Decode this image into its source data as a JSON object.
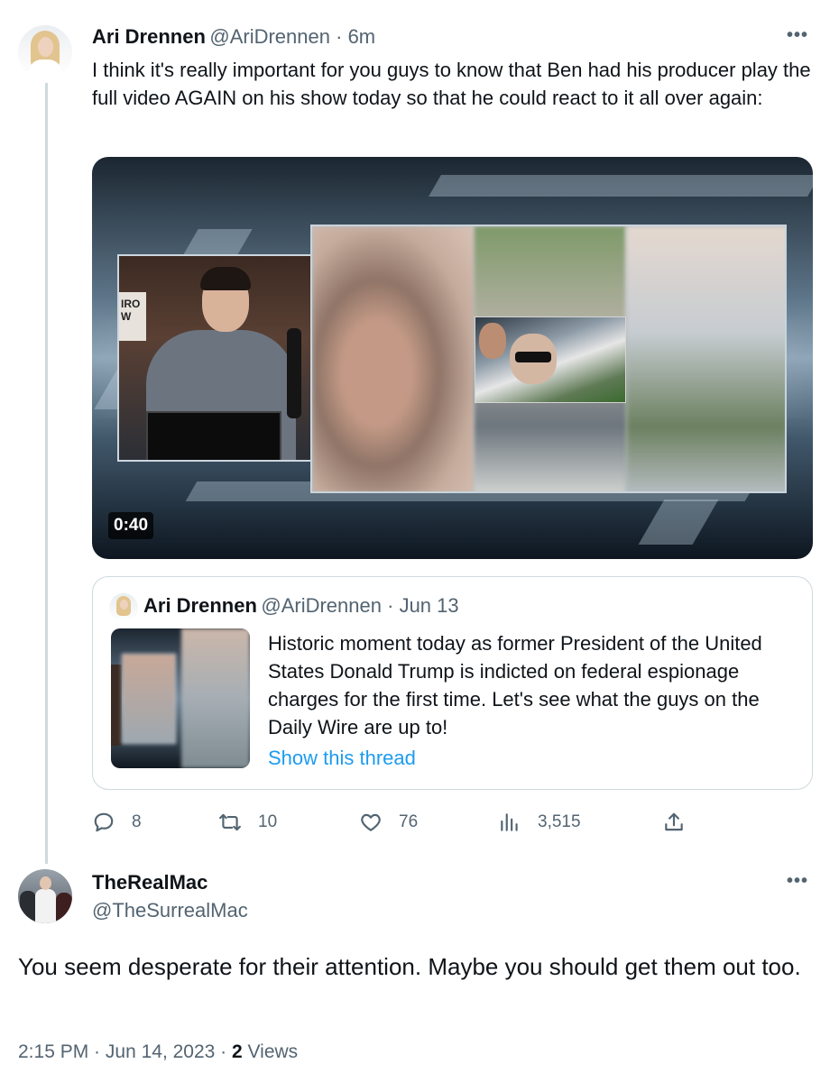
{
  "tweet1": {
    "name": "Ari Drennen",
    "handle": "@AriDrennen",
    "separator": " · ",
    "time": "6m",
    "text": "I think it's really important for you guys to know that Ben had his producer play the full video AGAIN on his show today so that he could react to it all over again:",
    "video": {
      "duration": "0:40",
      "sign_text": "IRO\nW"
    },
    "quote": {
      "name": "Ari Drennen",
      "handle": "@AriDrennen",
      "separator": " · ",
      "date": "Jun 13",
      "text": "Historic moment today as former President of the United States Donald Trump is indicted on federal espionage charges for the first time. Let's see what the guys on the Daily Wire are up to!",
      "show_thread": "Show this thread"
    },
    "actions": {
      "replies": "8",
      "retweets": "10",
      "likes": "76",
      "views": "3,515"
    }
  },
  "tweet2": {
    "name": "TheRealMac",
    "handle": "@TheSurrealMac",
    "text": "You seem desperate for their attention. Maybe you should get them out too.",
    "time": "2:15 PM",
    "date": "Jun 14, 2023",
    "separator": " · ",
    "views_count": "2",
    "views_label": " Views"
  },
  "icons": {
    "reply": "speech-bubble-icon",
    "retweet": "retweet-arrows-icon",
    "like": "heart-icon",
    "views": "bar-chart-icon",
    "share": "share-upload-icon",
    "more": "more-dots-icon"
  },
  "colors": {
    "link": "#1d9bf0",
    "secondary_text": "#536471",
    "primary_text": "#0f1419",
    "border": "#cfd9de"
  }
}
